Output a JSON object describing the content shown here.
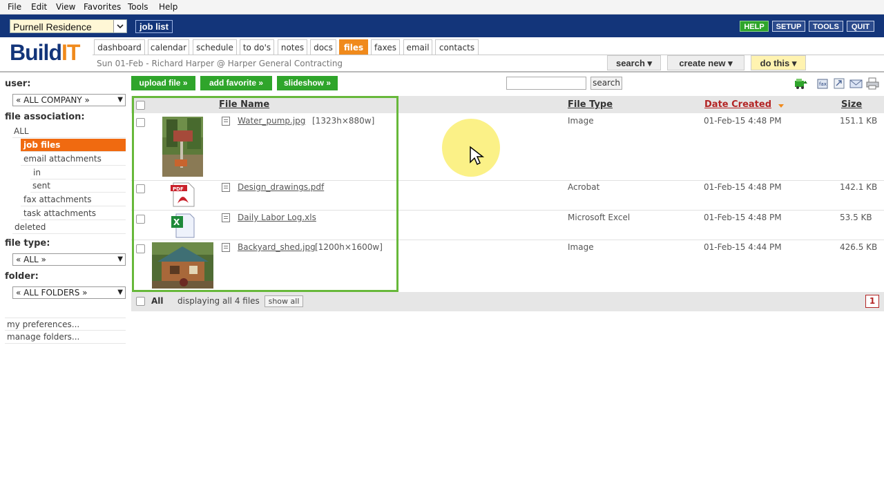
{
  "menu": [
    "File",
    "Edit",
    "View",
    "Favorites",
    "Tools",
    "Help"
  ],
  "header": {
    "job_name": "Purnell Residence",
    "job_list_label": "job list",
    "buttons": [
      "HELP",
      "SETUP",
      "TOOLS",
      "QUIT"
    ]
  },
  "logo": {
    "text_a": "Build",
    "text_b": "IT"
  },
  "tabs": [
    "dashboard",
    "calendar",
    "schedule",
    "to do's",
    "notes",
    "docs",
    "files",
    "faxes",
    "email",
    "contacts"
  ],
  "active_tab": "files",
  "subinfo": "Sun 01-Feb  -  Richard Harper  @ Harper General Contracting",
  "dropdowns": [
    "search ▾",
    "create new ▾",
    "do this ▾"
  ],
  "sidebar": {
    "user_label": "user:",
    "user_value": "« ALL COMPANY »",
    "assoc_label": "file association:",
    "assoc_items": [
      "ALL",
      "job files",
      "email attachments",
      "in",
      "sent",
      "fax attachments",
      "task attachments",
      "deleted"
    ],
    "filetype_label": "file type:",
    "filetype_value": "« ALL »",
    "folder_label": "folder:",
    "folder_value": "« ALL FOLDERS »",
    "links": [
      "my preferences...",
      "manage folders..."
    ]
  },
  "toolbar": {
    "upload": "upload file »",
    "favorite": "add favorite »",
    "slideshow": "slideshow »",
    "search_value": "",
    "search_label": "search"
  },
  "table": {
    "headers": {
      "name": "File Name",
      "type": "File Type",
      "date": "Date Created",
      "size": "Size"
    },
    "rows": [
      {
        "name": "Water_pump.jpg",
        "dims": "[1323h×880w]",
        "type": "Image",
        "date": "01-Feb-15 4:48 PM",
        "size": "151.1 KB"
      },
      {
        "name": "Design_drawings.pdf",
        "dims": "",
        "type": "Acrobat",
        "date": "01-Feb-15 4:48 PM",
        "size": "142.1 KB"
      },
      {
        "name": "Daily Labor Log.xls",
        "dims": "",
        "type": "Microsoft Excel",
        "date": "01-Feb-15 4:48 PM",
        "size": "53.5 KB"
      },
      {
        "name": "Backyard_shed.jpg",
        "dims": "[1200h×1600w]",
        "type": "Image",
        "date": "01-Feb-15 4:44 PM",
        "size": "426.5 KB"
      }
    ],
    "footer": {
      "all_label": "All",
      "display_text": "displaying all 4 files",
      "show_all": "show all",
      "page": "1"
    }
  },
  "colors": {
    "header_blue": "#13357a",
    "tab_orange": "#f08a1c",
    "button_green": "#2fa52b",
    "frame_green": "#67b83a",
    "sort_red": "#b32424"
  }
}
